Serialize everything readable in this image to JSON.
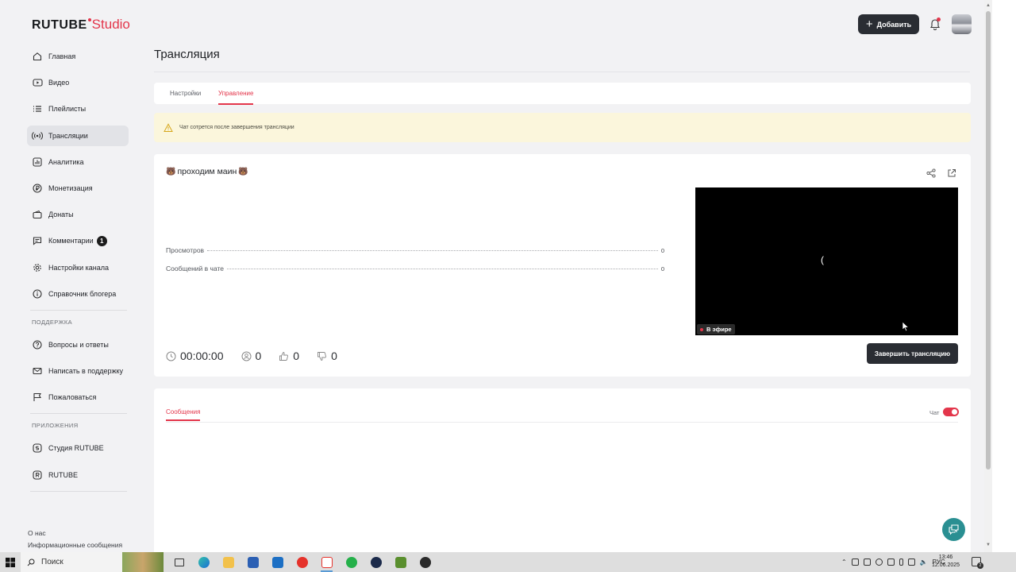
{
  "brand": {
    "name": "RUTUBE",
    "suffix": "Studio",
    "accent": "#e3364b"
  },
  "header": {
    "add_label": "Добавить"
  },
  "sidebar": {
    "items": [
      {
        "label": "Главная",
        "icon": "home-icon"
      },
      {
        "label": "Видео",
        "icon": "video-icon"
      },
      {
        "label": "Плейлисты",
        "icon": "playlist-icon"
      },
      {
        "label": "Трансляции",
        "icon": "broadcast-icon",
        "active": true
      },
      {
        "label": "Аналитика",
        "icon": "analytics-icon"
      },
      {
        "label": "Монетизация",
        "icon": "ruble-icon"
      },
      {
        "label": "Донаты",
        "icon": "wallet-icon"
      },
      {
        "label": "Комментарии",
        "icon": "comment-icon",
        "badge": "1"
      },
      {
        "label": "Настройки канала",
        "icon": "gear-icon"
      },
      {
        "label": "Справочник блогера",
        "icon": "info-icon"
      }
    ],
    "support_title": "ПОДДЕРЖКА",
    "support": [
      {
        "label": "Вопросы и ответы",
        "icon": "question-icon"
      },
      {
        "label": "Написать в поддержку",
        "icon": "mail-icon"
      },
      {
        "label": "Пожаловаться",
        "icon": "flag-icon"
      }
    ],
    "apps_title": "ПРИЛОЖЕНИЯ",
    "apps": [
      {
        "label": "Студия RUTUBE",
        "icon": "studio-app-icon"
      },
      {
        "label": "RUTUBE",
        "icon": "rutube-app-icon"
      }
    ],
    "footer": [
      "О нас",
      "Информационные сообщения"
    ]
  },
  "page": {
    "title": "Трансляция"
  },
  "tabs": [
    {
      "label": "Настройки"
    },
    {
      "label": "Управление",
      "active": true
    }
  ],
  "warning": {
    "text": "Чат сотрется после завершения трансляции"
  },
  "stream": {
    "title": "проходим маин",
    "title_emoji": "🐻",
    "stats": [
      {
        "label": "Просмотров",
        "value": "0"
      },
      {
        "label": "Сообщений в чате",
        "value": "0"
      }
    ],
    "live_label": "В эфире",
    "spinner": "(",
    "timer": "00:00:00",
    "viewers": "0",
    "likes": "0",
    "dislikes": "0",
    "end_label": "Завершить трансляцию"
  },
  "chat": {
    "tab_label": "Сообщения",
    "toggle_label": "Чат",
    "enabled": true
  },
  "taskbar": {
    "search_label": "Поиск",
    "lang": "РУС",
    "time": "13:46",
    "date": "12.06.2025",
    "notif_count": "2"
  }
}
